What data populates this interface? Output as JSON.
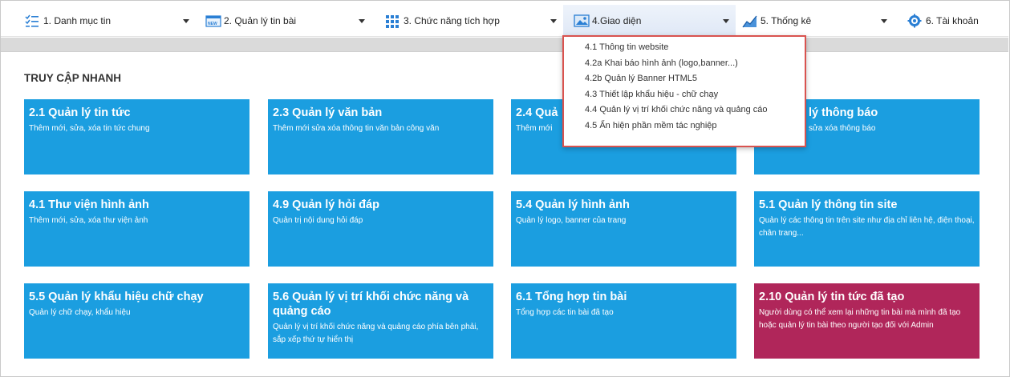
{
  "nav": [
    {
      "label": "1. Danh mục tin",
      "icon": "list-icon"
    },
    {
      "label": "2. Quản lý tin bài",
      "icon": "news-icon"
    },
    {
      "label": "3. Chức năng tích hợp",
      "icon": "grid-icon"
    },
    {
      "label": "4.Giao diện",
      "icon": "image-icon"
    },
    {
      "label": "5. Thống kê",
      "icon": "chart-icon"
    },
    {
      "label": "6. Tài khoản",
      "icon": "gear-icon"
    }
  ],
  "news_badge": "NEW",
  "dropdown": {
    "items": [
      "4.1 Thông tin website",
      "4.2a Khai báo hình ảnh (logo,banner...)",
      "4.2b Quản lý Banner HTML5",
      "4.3 Thiết lập khẩu hiệu - chữ chạy",
      "4.4 Quản lý vị trí khối chức năng và quảng cáo",
      "4.5 Ẩn hiện phần mềm tác nghiệp"
    ]
  },
  "quick_access": {
    "title": "TRUY CẬP NHANH",
    "tiles": [
      {
        "title": "2.1 Quản lý tin tức",
        "desc": "Thêm mới, sửa, xóa tin tức chung"
      },
      {
        "title": "2.3 Quản lý văn bản",
        "desc": "Thêm mới sửa xóa thông tin văn bản công văn"
      },
      {
        "title": "2.4 Quả",
        "desc": "Thêm mới"
      },
      {
        "title": "lý thông báo",
        "desc": "sửa xóa thông báo"
      },
      {
        "title": "4.1 Thư viện hình ảnh",
        "desc": "Thêm mới, sửa, xóa thư viện ảnh"
      },
      {
        "title": "4.9 Quản lý hỏi đáp",
        "desc": "Quản trị nội dung hỏi đáp"
      },
      {
        "title": "5.4 Quản lý hình ảnh",
        "desc": "Quản lý logo, banner của trang"
      },
      {
        "title": "5.1 Quản lý thông tin site",
        "desc": "Quản lý các thông tin trên site như địa chỉ liên hệ, điện thoại, chân trang..."
      },
      {
        "title": "5.5 Quản lý khẩu hiệu chữ chạy",
        "desc": "Quản lý chữ chạy, khẩu hiệu"
      },
      {
        "title": "5.6 Quản lý vị trí khối chức năng và quảng cáo",
        "desc": "Quản lý vị trí khối chức năng và quảng cáo phía bên phải, sắp xếp thứ tự hiển thị"
      },
      {
        "title": "6.1 Tổng hợp tin bài",
        "desc": "Tổng hợp các tin bài đã tạo"
      },
      {
        "title": "2.10 Quản lý tin tức đã tạo",
        "desc": "Người dùng có thể xem lại những tin bài mà mình đã tạo hoặc quản lý tin bài theo người tạo đối với Admin"
      }
    ]
  },
  "colors": {
    "tile": "#1b9ee0",
    "tile_alt": "#b0265a",
    "highlight_border": "#d9534f"
  }
}
